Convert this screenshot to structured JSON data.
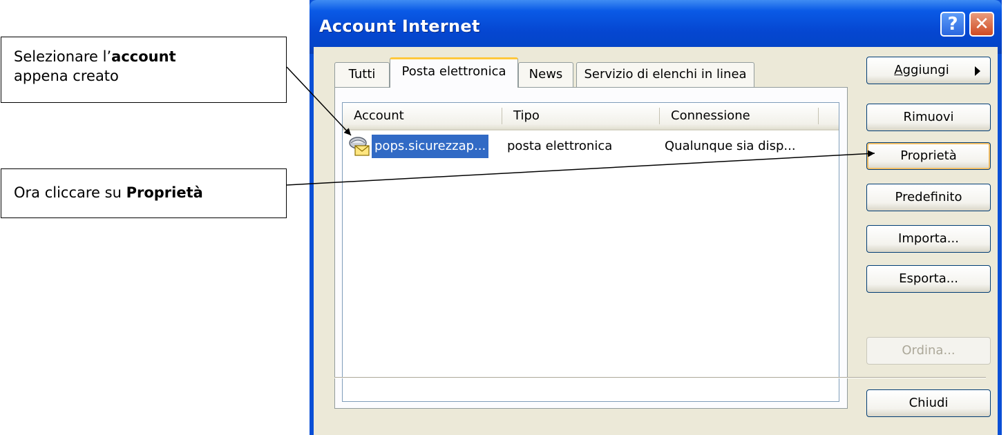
{
  "callouts": {
    "select": {
      "prefix": "Selezionare l’",
      "bold": "account",
      "suffix": "appena creato"
    },
    "click": {
      "prefix": "Ora cliccare su ",
      "bold": "Proprietà"
    }
  },
  "window": {
    "title": "Account Internet",
    "help_label": "?",
    "close_label": "✕",
    "tabs": [
      {
        "label": "Tutti",
        "active": false
      },
      {
        "label": "Posta elettronica",
        "active": true
      },
      {
        "label": "News",
        "active": false
      },
      {
        "label": "Servizio di elenchi in linea",
        "active": false
      }
    ],
    "list": {
      "columns": [
        "Account",
        "Tipo",
        "Connessione"
      ],
      "rows": [
        {
          "account": "pops.sicurezzap...",
          "tipo": "posta elettronica",
          "connessione": "Qualunque sia disp...",
          "selected": true,
          "icon": "mail-account-icon"
        }
      ]
    },
    "buttons": {
      "aggiungi": {
        "underlined_char": "A",
        "rest": "ggiungi"
      },
      "rimuovi": "Rimuovi",
      "proprieta": "Proprietà",
      "predefinito": "Predefinito",
      "importa": "Importa...",
      "esporta": "Esporta...",
      "ordina": "Ordina...",
      "chiudi": "Chiudi"
    },
    "colors": {
      "titlebar": "#0a5ae6",
      "selection": "#316ac5",
      "tab_accent": "#ffc83c"
    }
  }
}
